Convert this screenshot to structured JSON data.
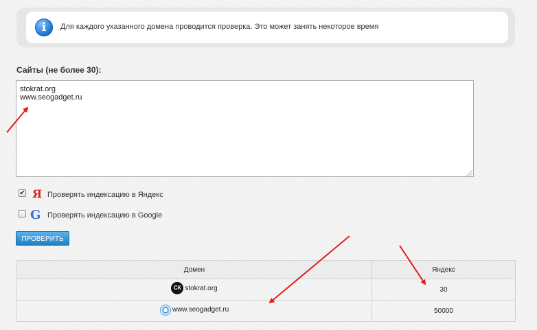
{
  "info": {
    "icon": "info-icon",
    "text": "Для каждого указанного домена проводится проверка. Это может занять некоторое время"
  },
  "form": {
    "sites_label": "Сайты (не более 30):",
    "sites_value": "stokrat.org\nwww.seogadget.ru",
    "yandex": {
      "label": "Проверять индексацию в Яндекс",
      "checked": true,
      "icon": "yandex-logo-icon"
    },
    "google": {
      "label": "Проверять индексацию в Google",
      "checked": false,
      "icon": "google-logo-icon"
    },
    "submit_label": "Проверить"
  },
  "results": {
    "columns": [
      "Домен",
      "Яндекс"
    ],
    "rows": [
      {
        "domain": "stokrat.org",
        "favicon": "stokrat-favicon-icon",
        "favicon_text": "СК",
        "yandex": "30"
      },
      {
        "domain": "www.seogadget.ru",
        "favicon": "seogadget-favicon-icon",
        "yandex": "50000"
      }
    ]
  },
  "colors": {
    "accent_button": "#2a8fd6",
    "annotation_arrow": "#e31b1b",
    "yandex_red": "#e01e1e",
    "google_blue": "#3a6fd8"
  }
}
